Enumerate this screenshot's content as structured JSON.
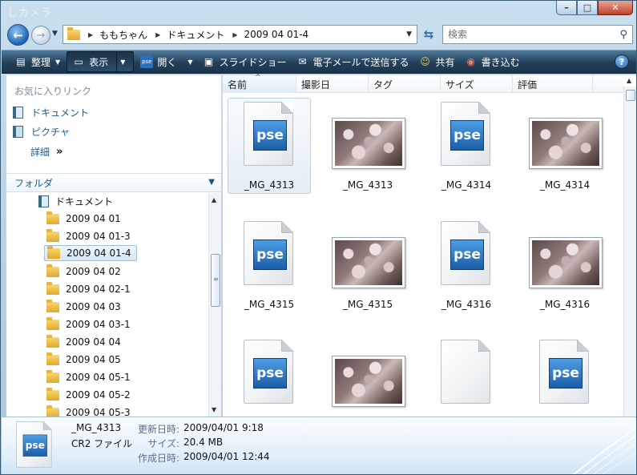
{
  "window": {
    "ghost_title": "しカメラ",
    "minimize": "–",
    "maximize": "□",
    "close": "✕"
  },
  "nav": {
    "breadcrumbs": [
      "ももちゃん",
      "ドキュメント",
      "2009 04 01-4"
    ],
    "search_placeholder": "検索"
  },
  "toolbar": {
    "organize": "整理",
    "views": "表示",
    "open": "開く",
    "slideshow": "スライドショー",
    "email": "電子メールで送信する",
    "share": "共有",
    "burn": "書き込む",
    "help": "?"
  },
  "sidebar": {
    "favorites_title": "お気に入りリンク",
    "favorites": [
      {
        "label": "ドキュメント",
        "icon": "documents-icon"
      },
      {
        "label": "ピクチャ",
        "icon": "pictures-icon"
      }
    ],
    "more": "詳細",
    "folders_title": "フォルダ",
    "tree_parent": "ドキュメント",
    "tree_items": [
      "2009 04 01",
      "2009 04 01-3",
      "2009 04 01-4",
      "2009 04 02",
      "2009 04 02-1",
      "2009 04 03",
      "2009 04 03-1",
      "2009 04 04",
      "2009 04 05",
      "2009 04 05-1",
      "2009 04 05-2",
      "2009 04 05-3"
    ],
    "selected": "2009 04 01-4"
  },
  "columns": [
    "名前",
    "撮影日",
    "タグ",
    "サイズ",
    "評価"
  ],
  "files": [
    {
      "name": "_MG_4313",
      "kind": "pse",
      "selected": true
    },
    {
      "name": "_MG_4313",
      "kind": "photo"
    },
    {
      "name": "_MG_4314",
      "kind": "pse"
    },
    {
      "name": "_MG_4314",
      "kind": "photo"
    },
    {
      "name": "_MG_4315",
      "kind": "pse"
    },
    {
      "name": "_MG_4315",
      "kind": "photo"
    },
    {
      "name": "_MG_4316",
      "kind": "pse"
    },
    {
      "name": "_MG_4316",
      "kind": "photo"
    },
    {
      "name": "",
      "kind": "pse"
    },
    {
      "name": "",
      "kind": "photo"
    },
    {
      "name": "",
      "kind": "blank"
    },
    {
      "name": "",
      "kind": "pse"
    }
  ],
  "pse_text": "pse",
  "details": {
    "name": "_MG_4313",
    "type": "CR2 ファイル",
    "modified_label": "更新日時:",
    "modified": "2009/04/01 9:18",
    "size_label": "サイズ:",
    "size": "20.4 MB",
    "created_label": "作成日時:",
    "created": "2009/04/01 12:44"
  },
  "colors": {
    "accent": "#1f5b8f",
    "toolbar_dark": "#233f58"
  }
}
